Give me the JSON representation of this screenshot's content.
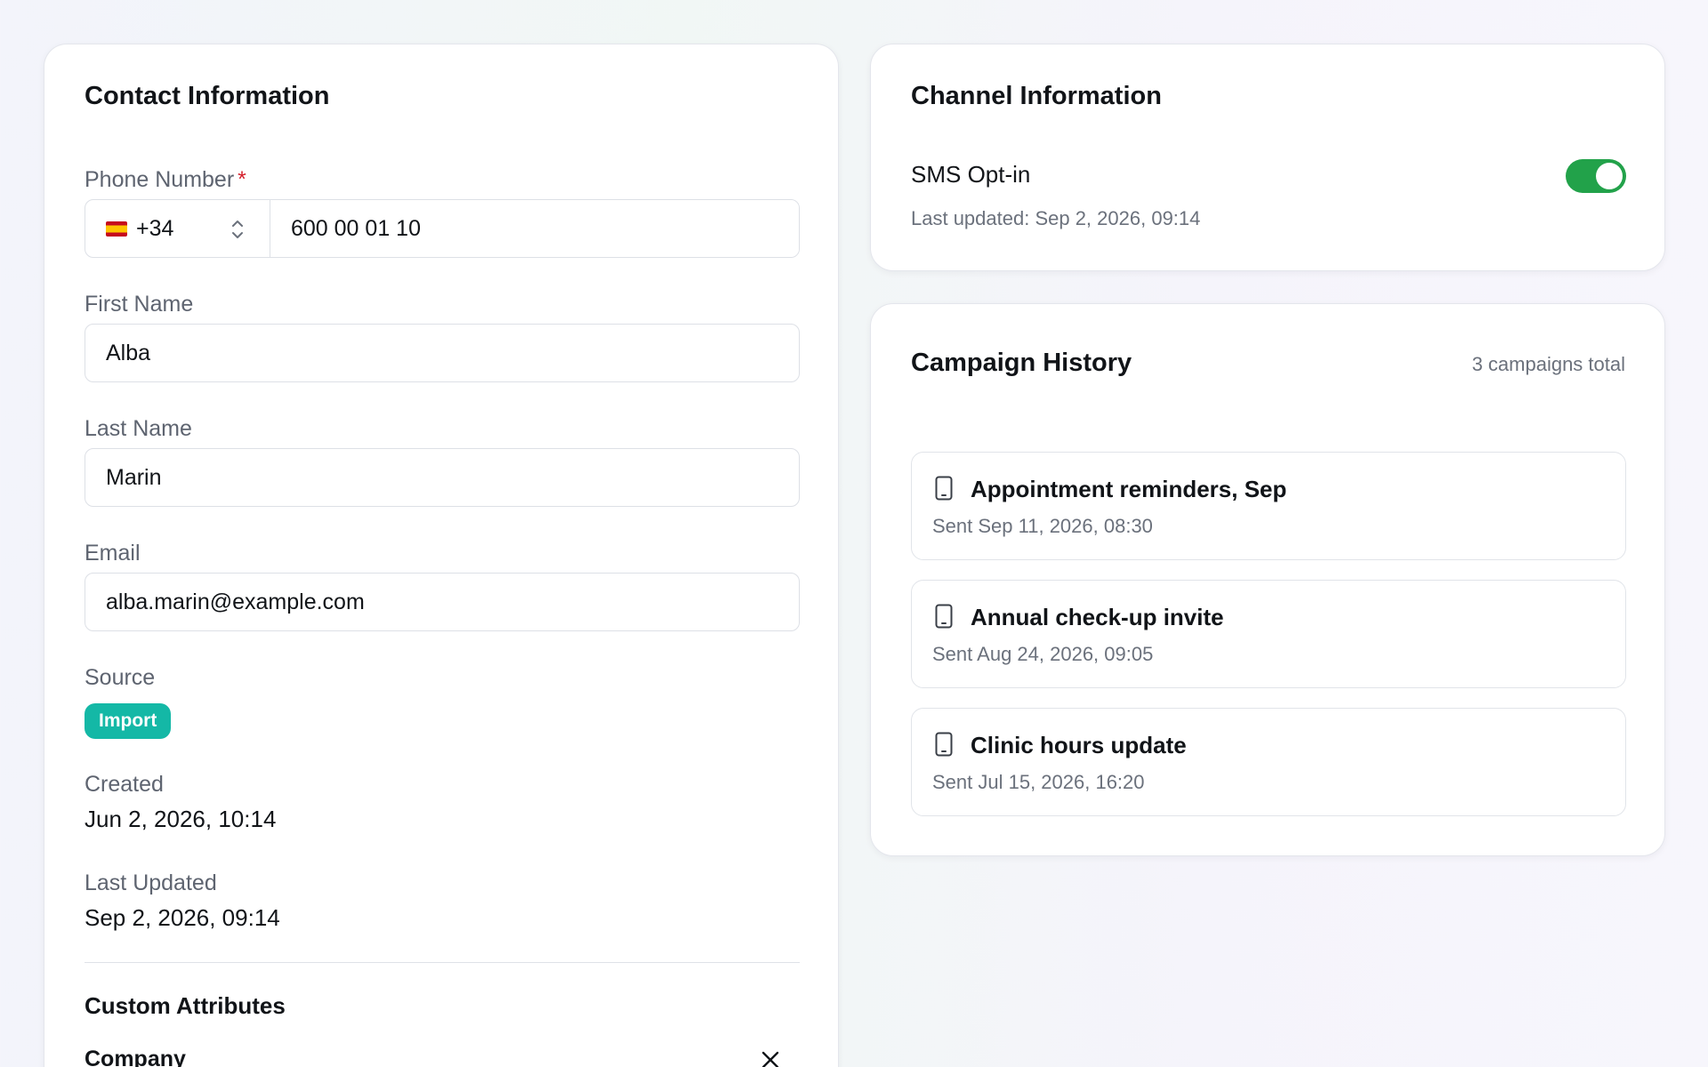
{
  "contact": {
    "title": "Contact Information",
    "phone": {
      "label": "Phone Number",
      "required_mark": "*",
      "country_code": "+34",
      "country_flag": "spain-flag",
      "value": "600 00 01 10"
    },
    "first_name": {
      "label": "First Name",
      "value": "Alba"
    },
    "last_name": {
      "label": "Last Name",
      "value": "Marin"
    },
    "email": {
      "label": "Email",
      "value": "alba.marin@example.com"
    },
    "source": {
      "label": "Source",
      "badge": "Import",
      "badge_color": "#14b8a6"
    },
    "created": {
      "label": "Created",
      "value": "Jun 2, 2026, 10:14"
    },
    "last_updated": {
      "label": "Last Updated",
      "value": "Sep 2, 2026, 09:14"
    },
    "custom_attributes": {
      "title": "Custom Attributes",
      "items": [
        {
          "label": "Company"
        }
      ]
    }
  },
  "channel": {
    "title": "Channel Information",
    "sms_optin": {
      "label": "SMS Opt-in",
      "enabled": true,
      "toggle_color": "#22a24a",
      "updated": "Last updated: Sep 2, 2026, 09:14"
    }
  },
  "campaigns": {
    "title": "Campaign History",
    "total": "3 campaigns total",
    "items": [
      {
        "name": "Appointment reminders, Sep",
        "sent": "Sent Sep 11, 2026, 08:30",
        "icon": "mobile-device-icon"
      },
      {
        "name": "Annual check-up invite",
        "sent": "Sent Aug 24, 2026, 09:05",
        "icon": "mobile-device-icon"
      },
      {
        "name": "Clinic hours update",
        "sent": "Sent Jul 15, 2026, 16:20",
        "icon": "mobile-device-icon"
      }
    ]
  }
}
